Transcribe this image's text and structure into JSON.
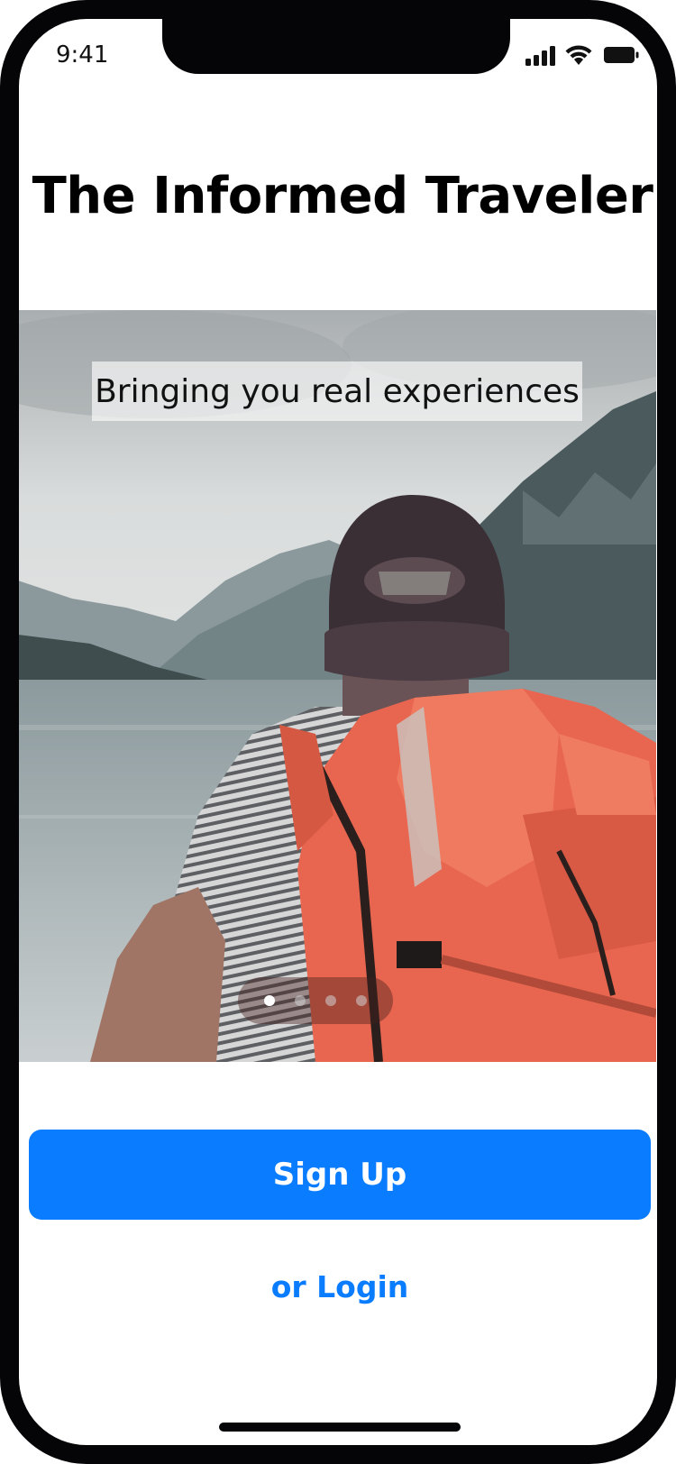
{
  "status_bar": {
    "time": "9:41",
    "icons": [
      "signal-icon",
      "wifi-icon",
      "battery-icon"
    ]
  },
  "app": {
    "title": "The Informed Traveler"
  },
  "carousel": {
    "image": "hiker-with-orange-backpack-at-mountain-lake",
    "tagline": "Bringing you real experiences",
    "page_count": 4,
    "active_page": 1
  },
  "actions": {
    "signup_label": "Sign Up",
    "login_label": "or Login"
  },
  "colors": {
    "accent": "#0a7cff",
    "frame": "#050507",
    "backpack": "#e8664f"
  }
}
